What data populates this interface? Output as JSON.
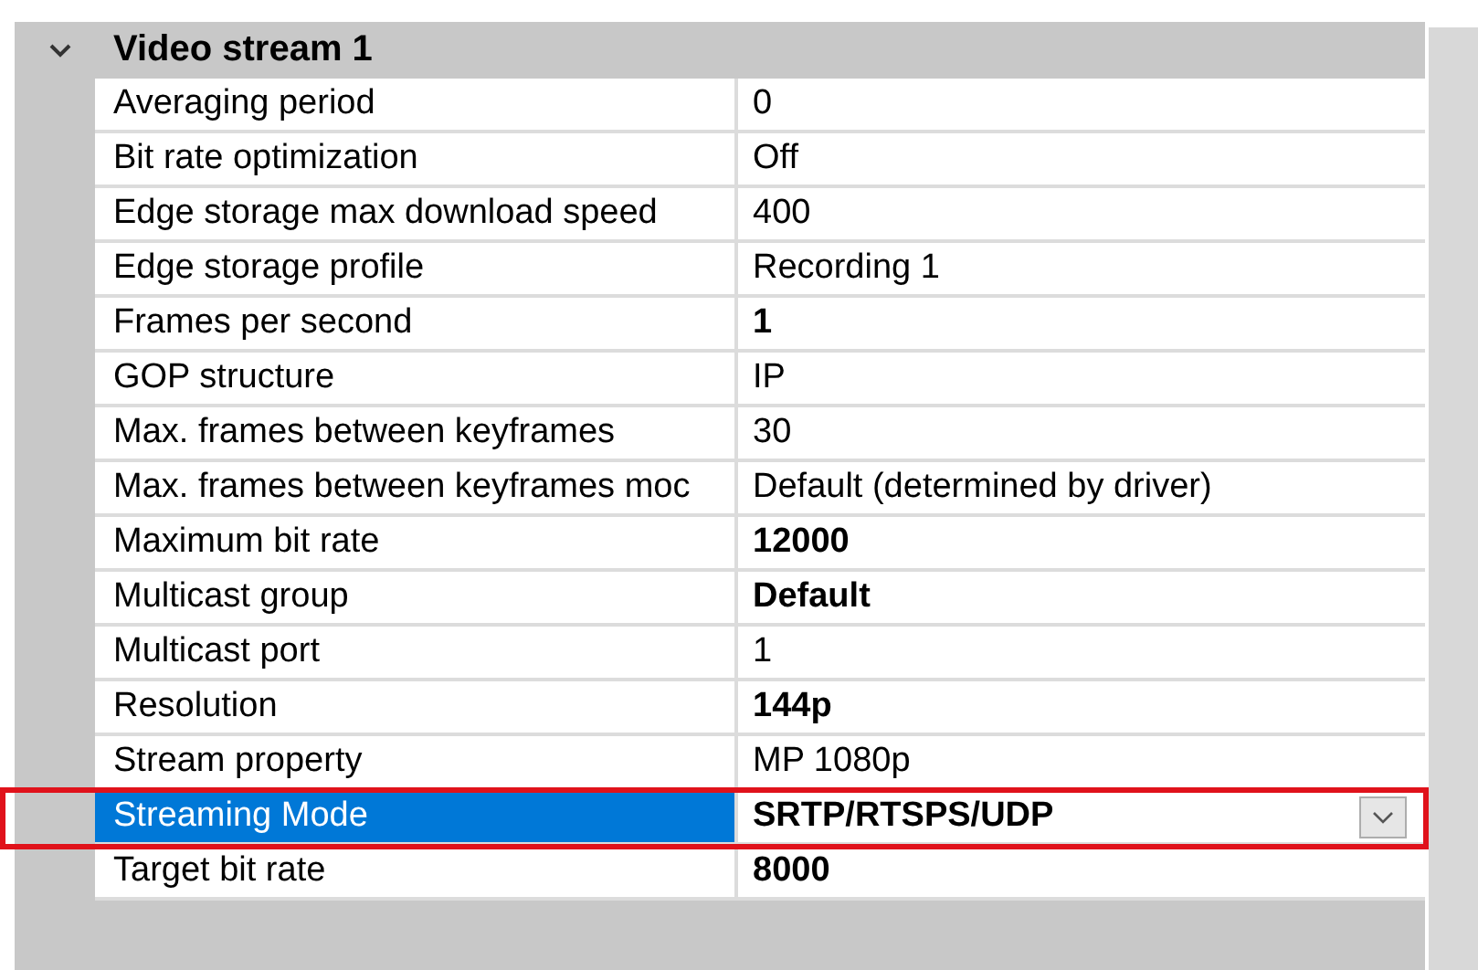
{
  "category": {
    "title": "Video stream 1",
    "expanded": true
  },
  "rows": [
    {
      "name": "Averaging period",
      "value": "0",
      "modified": false,
      "selected": false,
      "highlighted": false
    },
    {
      "name": "Bit rate optimization",
      "value": "Off",
      "modified": false,
      "selected": false,
      "highlighted": false
    },
    {
      "name": "Edge storage max download speed",
      "value": "400",
      "modified": false,
      "selected": false,
      "highlighted": false
    },
    {
      "name": "Edge storage profile",
      "value": "Recording 1",
      "modified": false,
      "selected": false,
      "highlighted": false
    },
    {
      "name": "Frames per second",
      "value": "1",
      "modified": true,
      "selected": false,
      "highlighted": false
    },
    {
      "name": "GOP structure",
      "value": "IP",
      "modified": false,
      "selected": false,
      "highlighted": false
    },
    {
      "name": "Max. frames between keyframes",
      "value": "30",
      "modified": false,
      "selected": false,
      "highlighted": false
    },
    {
      "name": "Max. frames between keyframes moc",
      "value": "Default (determined by driver)",
      "modified": false,
      "selected": false,
      "highlighted": false
    },
    {
      "name": "Maximum bit rate",
      "value": "12000",
      "modified": true,
      "selected": false,
      "highlighted": false
    },
    {
      "name": "Multicast group",
      "value": "Default",
      "modified": true,
      "selected": false,
      "highlighted": false
    },
    {
      "name": "Multicast port",
      "value": "1",
      "modified": false,
      "selected": false,
      "highlighted": false
    },
    {
      "name": "Resolution",
      "value": "144p",
      "modified": true,
      "selected": false,
      "highlighted": false
    },
    {
      "name": "Stream property",
      "value": "MP 1080p",
      "modified": false,
      "selected": false,
      "highlighted": false
    },
    {
      "name": "Streaming Mode",
      "value": "SRTP/RTSPS/UDP",
      "modified": true,
      "selected": true,
      "highlighted": true
    },
    {
      "name": "Target bit rate",
      "value": "8000",
      "modified": true,
      "selected": false,
      "highlighted": false
    }
  ]
}
